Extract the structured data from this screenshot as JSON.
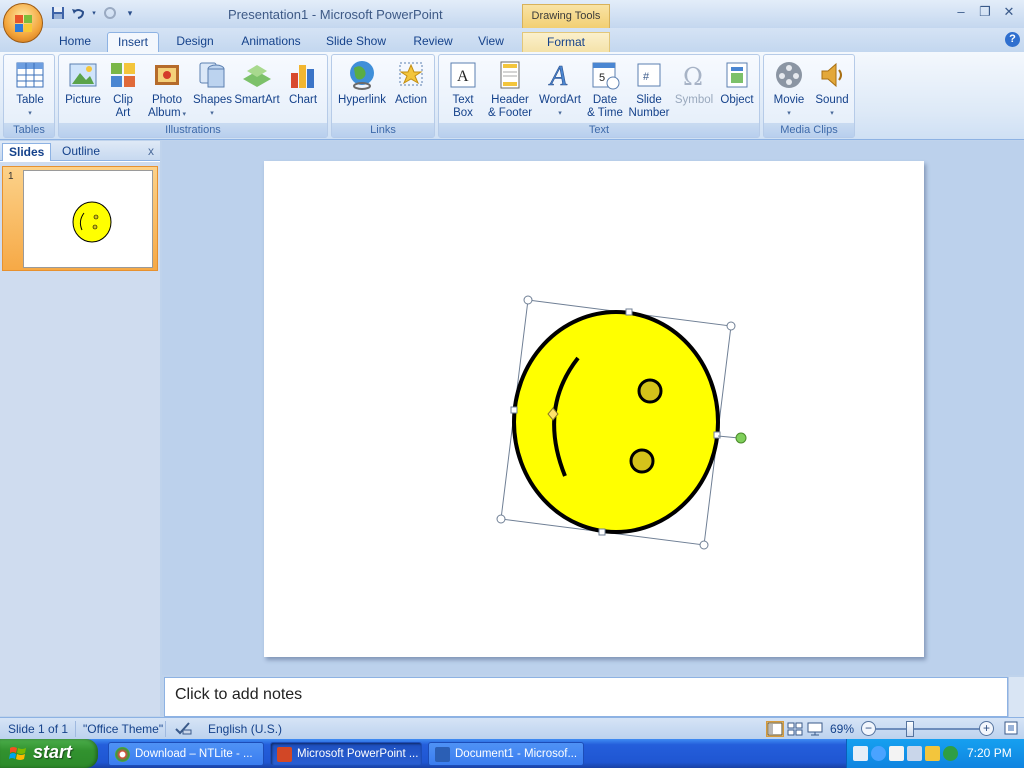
{
  "window": {
    "title": "Presentation1 - Microsoft PowerPoint",
    "context_tab": "Drawing Tools"
  },
  "tabs": [
    "Home",
    "Insert",
    "Design",
    "Animations",
    "Slide Show",
    "Review",
    "View",
    "Format"
  ],
  "active_tab": "Insert",
  "ribbon": {
    "groups": {
      "tables": "Tables",
      "illustrations": "Illustrations",
      "links": "Links",
      "text": "Text",
      "media": "Media Clips"
    },
    "buttons": {
      "table": [
        "Table"
      ],
      "picture": [
        "Picture"
      ],
      "clipart": [
        "Clip",
        "Art"
      ],
      "photoalbum": [
        "Photo",
        "Album"
      ],
      "shapes": [
        "Shapes"
      ],
      "smartart": [
        "SmartArt"
      ],
      "chart": [
        "Chart"
      ],
      "hyperlink": [
        "Hyperlink"
      ],
      "action": [
        "Action"
      ],
      "textbox": [
        "Text",
        "Box"
      ],
      "headerfooter": [
        "Header",
        "& Footer"
      ],
      "wordart": [
        "WordArt"
      ],
      "datetime": [
        "Date",
        "& Time"
      ],
      "slidenumber": [
        "Slide",
        "Number"
      ],
      "symbol": [
        "Symbol"
      ],
      "object": [
        "Object"
      ],
      "movie": [
        "Movie"
      ],
      "sound": [
        "Sound"
      ]
    }
  },
  "slides_pane": {
    "tab_slides": "Slides",
    "tab_outline": "Outline",
    "close": "x",
    "slide_number": "1"
  },
  "notes": {
    "placeholder": "Click to add notes"
  },
  "status": {
    "slide": "Slide 1 of 1",
    "theme": "\"Office Theme\"",
    "language": "English (U.S.)",
    "zoom": "69%"
  },
  "taskbar": {
    "start": "start",
    "tasks": [
      "Download – NTLite - ...",
      "Microsoft PowerPoint ...",
      "Document1 - Microsof..."
    ],
    "clock": "7:20 PM"
  },
  "colors": {
    "smiley_fill": "#ffff00",
    "eye_fill": "#d4c21a",
    "ribbon_text": "#15428b"
  }
}
